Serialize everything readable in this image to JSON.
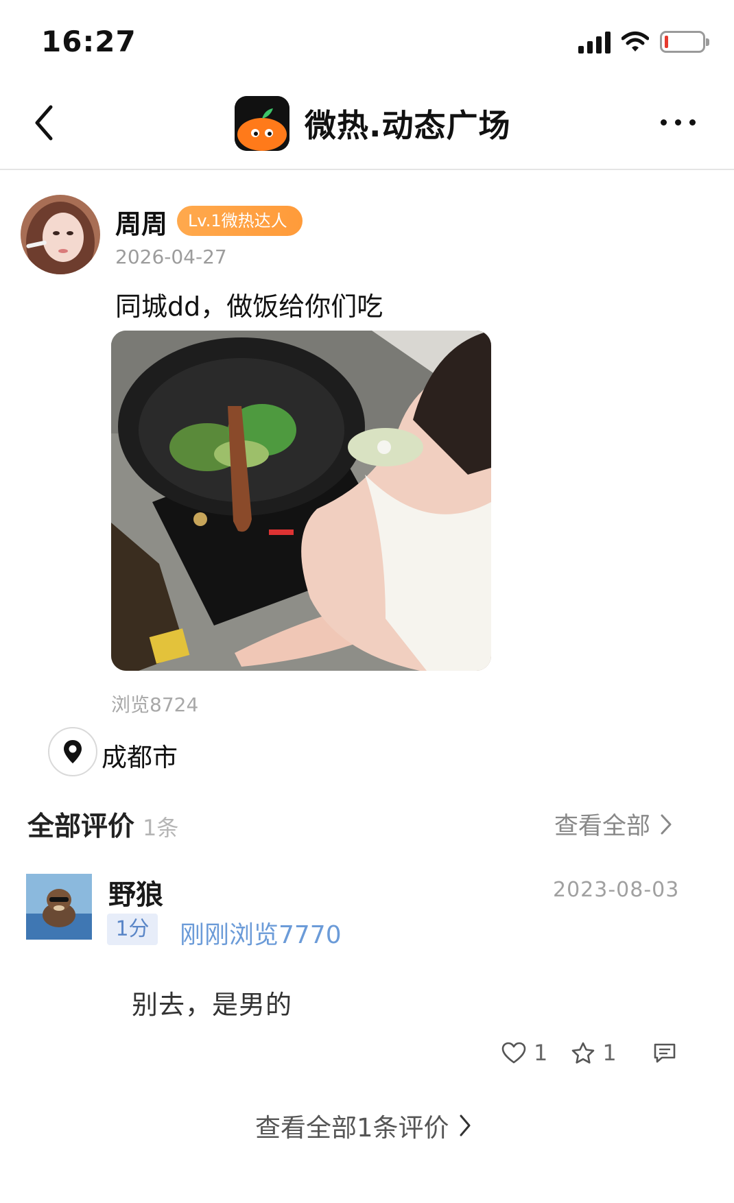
{
  "status_bar": {
    "time": "16:27",
    "icons": [
      "signal-icon",
      "wifi-icon",
      "battery-low-icon"
    ],
    "battery_color": "#e63a2e"
  },
  "nav": {
    "title": "微热.动态广场",
    "back_icon": "chevron-left-icon",
    "more_icon": "more-dots-icon",
    "logo_colors": {
      "background": "#111111",
      "orange": "#ff7a1a",
      "leaf": "#3cc46a"
    }
  },
  "post": {
    "author": "周周",
    "level_badge": "Lv.1微热达人",
    "level_badge_color": "#ff9b3a",
    "date": "2026-04-27",
    "text": "同城dd，做饭给你们吃",
    "views": "浏览8724",
    "location": "成都市",
    "location_icon": "map-pin-icon"
  },
  "reviews": {
    "title": "全部评价",
    "count": "1条",
    "view_all": "查看全部",
    "comment": {
      "author": "野狼",
      "date": "2023-08-03",
      "score": "1分",
      "views": "刚刚浏览7770",
      "text": "别去，是男的",
      "likes": "1",
      "favorites": "1",
      "link_color": "#6b9bd8"
    },
    "all_comments_link": "查看全部1条评价"
  }
}
